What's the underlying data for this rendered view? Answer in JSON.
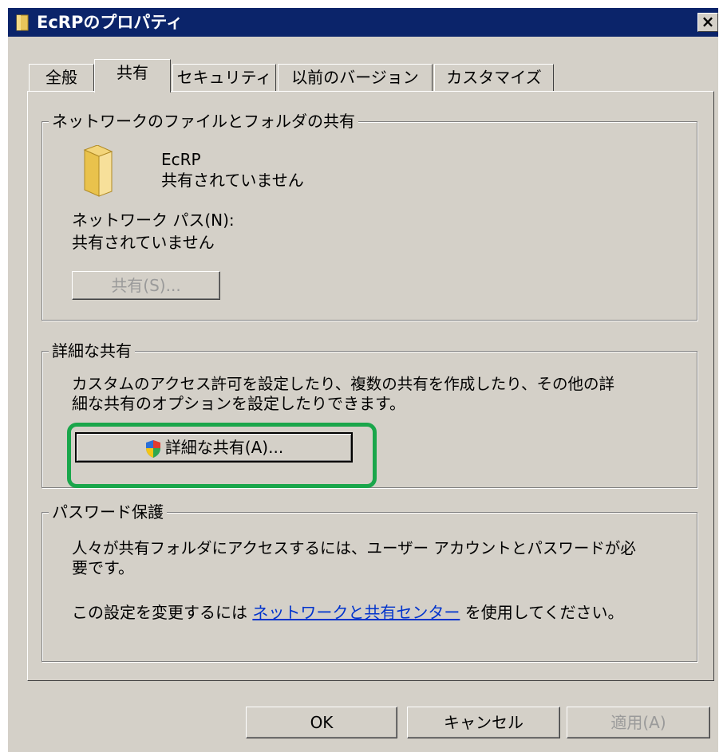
{
  "window": {
    "title": "EcRPのプロパティ",
    "close_label": "×"
  },
  "tabs": [
    {
      "label": "全般",
      "active": false
    },
    {
      "label": "共有",
      "active": true
    },
    {
      "label": "セキュリティ",
      "active": false
    },
    {
      "label": "以前のバージョン",
      "active": false
    },
    {
      "label": "カスタマイズ",
      "active": false
    }
  ],
  "network_sharing": {
    "legend": "ネットワークのファイルとフォルダの共有",
    "folder_name": "EcRP",
    "folder_status": "共有されていません",
    "path_label": "ネットワーク パス(N):",
    "path_value": "共有されていません",
    "share_button": "共有(S)..."
  },
  "advanced_sharing": {
    "legend": "詳細な共有",
    "description_line1": "カスタムのアクセス許可を設定したり、複数の共有を作成したり、その他の詳",
    "description_line2": "細な共有のオプションを設定したりできます。",
    "button_label": "詳細な共有(A)..."
  },
  "password_protection": {
    "legend": "パスワード保護",
    "line1": "人々が共有フォルダにアクセスするには、ユーザー アカウントとパスワードが必",
    "line2": "要です。",
    "change_prefix": "この設定を変更するには",
    "link_text": "ネットワークと共有センター",
    "change_suffix": "を使用してください。"
  },
  "footer": {
    "ok": "OK",
    "cancel": "キャンセル",
    "apply": "適用(A)"
  },
  "colors": {
    "titlebar": "#0b246a",
    "highlight": "#1aa64b",
    "link": "#0033cc"
  }
}
